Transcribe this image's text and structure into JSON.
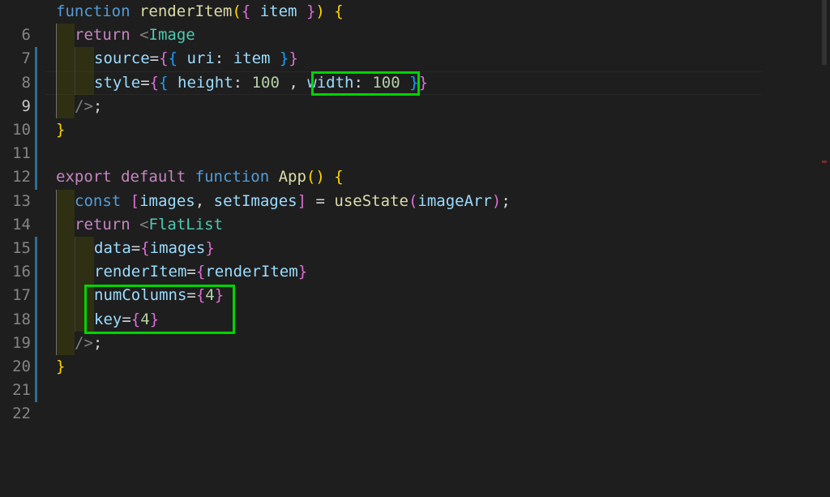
{
  "editor": {
    "lines": [
      {
        "num": "6"
      },
      {
        "num": "7"
      },
      {
        "num": "8"
      },
      {
        "num": "9"
      },
      {
        "num": "10"
      },
      {
        "num": "11"
      },
      {
        "num": "12"
      },
      {
        "num": "13"
      },
      {
        "num": "14"
      },
      {
        "num": "15"
      },
      {
        "num": "16"
      },
      {
        "num": "17"
      },
      {
        "num": "18"
      },
      {
        "num": "19"
      },
      {
        "num": "20"
      },
      {
        "num": "21"
      },
      {
        "num": "22"
      }
    ],
    "code": {
      "l6": {
        "kw": "function",
        "fn": "renderItem",
        "param": "item"
      },
      "l7": {
        "kw": "return",
        "tag": "Image"
      },
      "l8": {
        "attr": "source",
        "key": "uri",
        "val": "item"
      },
      "l9": {
        "attr": "style",
        "k1": "height",
        "v1": "100",
        "k2": "width",
        "v2": "100"
      },
      "l13": {
        "kw1": "export",
        "kw2": "default",
        "kw3": "function",
        "fn": "App"
      },
      "l14": {
        "kw": "const",
        "a": "images",
        "b": "setImages",
        "fn": "useState",
        "arg": "imageArr"
      },
      "l15": {
        "kw": "return",
        "tag": "FlatList"
      },
      "l16": {
        "attr": "data",
        "val": "images"
      },
      "l17": {
        "attr": "renderItem",
        "val": "renderItem"
      },
      "l18": {
        "attr": "numColumns",
        "val": "4"
      },
      "l19": {
        "attr": "key",
        "val": "4"
      }
    }
  },
  "colors": {
    "background": "#1e1e1e",
    "highlight_box": "#00d400",
    "keyword": "#569cd6",
    "control_keyword": "#c586c0",
    "function": "#dcdcaa",
    "variable": "#9cdcfe",
    "component": "#4ec9b0",
    "number": "#b5cea8"
  }
}
